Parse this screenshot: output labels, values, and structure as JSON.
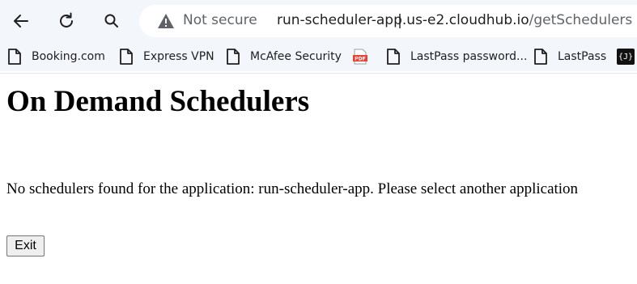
{
  "browser": {
    "security_label": "Not secure",
    "url_host": "run-scheduler-app.us-e2.cloudhub.io",
    "url_path": "/getSchedulers",
    "bookmarks": [
      {
        "label": "Booking.com",
        "icon": "page-icon"
      },
      {
        "label": "Express VPN",
        "icon": "page-icon"
      },
      {
        "label": "McAfee Security",
        "icon": "page-icon"
      },
      {
        "label": "",
        "icon": "pdf-icon"
      },
      {
        "label": "LastPass password...",
        "icon": "page-icon"
      },
      {
        "label": "LastPass",
        "icon": "page-icon"
      },
      {
        "label": "{J}",
        "icon": "json-icon"
      }
    ]
  },
  "page": {
    "title": "On Demand Schedulers",
    "message": "No schedulers found for the application: run-scheduler-app. Please select another application",
    "exit_label": "Exit"
  },
  "colors": {
    "chrome_bg": "#f3f6fb",
    "omnibox_bg": "#ffffff",
    "muted_text": "#5f6368",
    "pdf_red": "#e94235"
  }
}
